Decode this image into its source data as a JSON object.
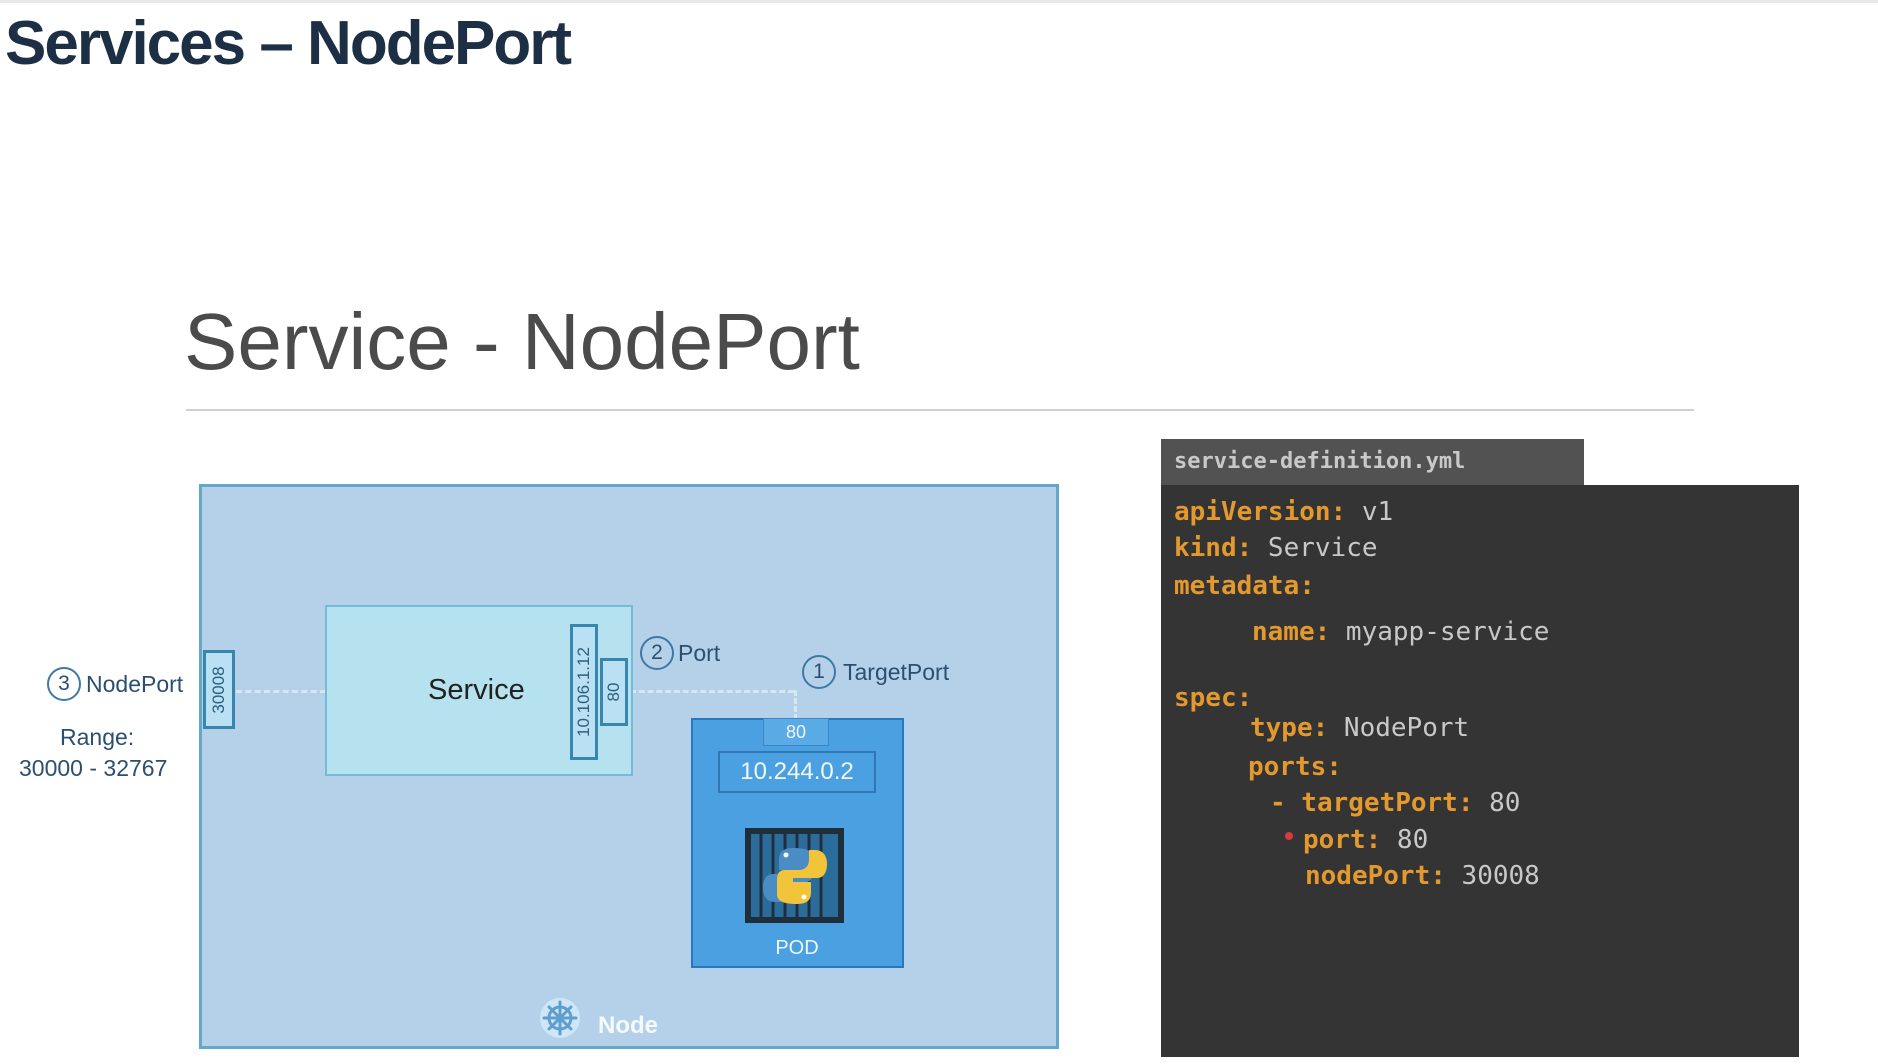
{
  "page_title": "Services – NodePort",
  "slide": {
    "title": "Service - NodePort"
  },
  "diagram": {
    "service_label": "Service",
    "service_ip": "10.106.1.12",
    "service_port": "80",
    "node_port_value": "30008",
    "callouts": {
      "nodeport": {
        "number": "3",
        "label": "NodePort"
      },
      "port": {
        "number": "2",
        "label": "Port"
      },
      "targetport": {
        "number": "1",
        "label": "TargetPort"
      }
    },
    "range_label": "Range:",
    "range_value": "30000 - 32767",
    "pod": {
      "port": "80",
      "ip": "10.244.0.2",
      "label": "POD",
      "icon": "python-container-icon"
    },
    "node_label": "Node",
    "node_icon": "kubernetes-helm-icon",
    "colors": {
      "node_bg": "#b5d0e9",
      "service_bg": "#b6e2ef",
      "pod_bg": "#4aa0e0"
    }
  },
  "yaml": {
    "filename": "service-definition.yml",
    "lines": {
      "api_key": "apiVersion:",
      "api_val": " v1",
      "kind_key": "kind:",
      "kind_val": " Service",
      "meta_key": "metadata:",
      "name_key": "name:",
      "name_val": " myapp-service",
      "spec_key": "spec:",
      "type_key": "type:",
      "type_val": " NodePort",
      "ports_key": "ports:",
      "tp_key": "- targetPort:",
      "tp_val": " 80",
      "port_key": "port:",
      "port_val": " 80",
      "np_key": "nodePort:",
      "np_val": " 30008"
    },
    "colors": {
      "key": "#e3992d",
      "value": "#c8c8c8",
      "bg": "#343434"
    }
  }
}
